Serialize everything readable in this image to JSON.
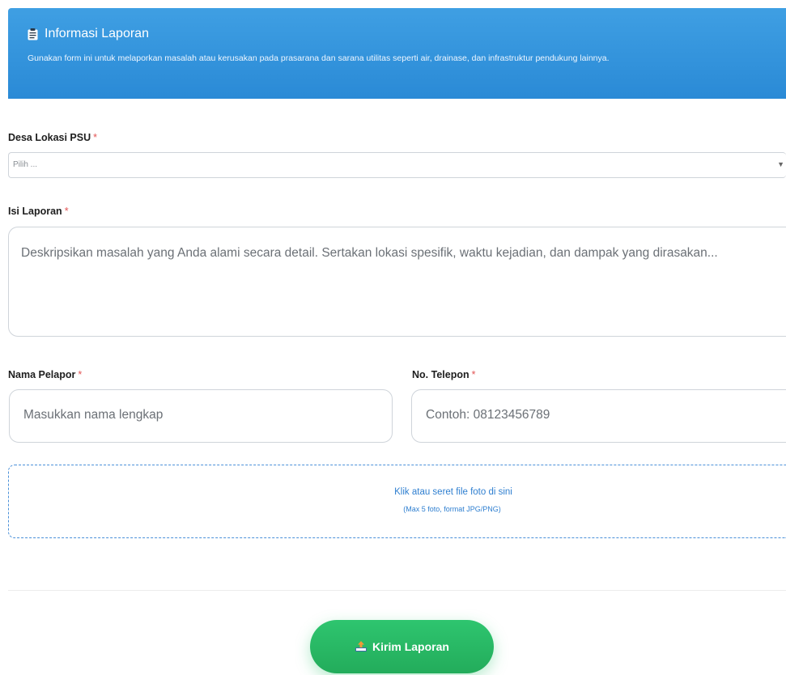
{
  "banner": {
    "icon": "clipboard-icon",
    "title": "Informasi Laporan",
    "description": "Gunakan form ini untuk melaporkan masalah atau kerusakan pada prasarana dan sarana utilitas seperti air, drainase, dan infrastruktur pendukung lainnya."
  },
  "form": {
    "required_marker": "*",
    "desa": {
      "label": "Desa Lokasi PSU",
      "placeholder": "Pilih ..."
    },
    "isi_laporan": {
      "label": "Isi Laporan",
      "placeholder": "Deskripsikan masalah yang Anda alami secara detail. Sertakan lokasi spesifik, waktu kejadian, dan dampak yang dirasakan..."
    },
    "nama_pelapor": {
      "label": "Nama Pelapor",
      "placeholder": "Masukkan nama lengkap"
    },
    "telepon": {
      "label": "No. Telepon",
      "placeholder": "Contoh: 08123456789"
    },
    "upload": {
      "main_text": "Klik atau seret file foto di sini",
      "sub_text": "(Max 5 foto, format JPG/PNG)"
    },
    "submit": {
      "icon": "upload-icon",
      "label": "Kirim Laporan"
    }
  },
  "colors": {
    "banner": "#2a8ad6",
    "accent_green": "#23ac5b",
    "required": "#e25555",
    "link_blue": "#2f7fd0"
  }
}
